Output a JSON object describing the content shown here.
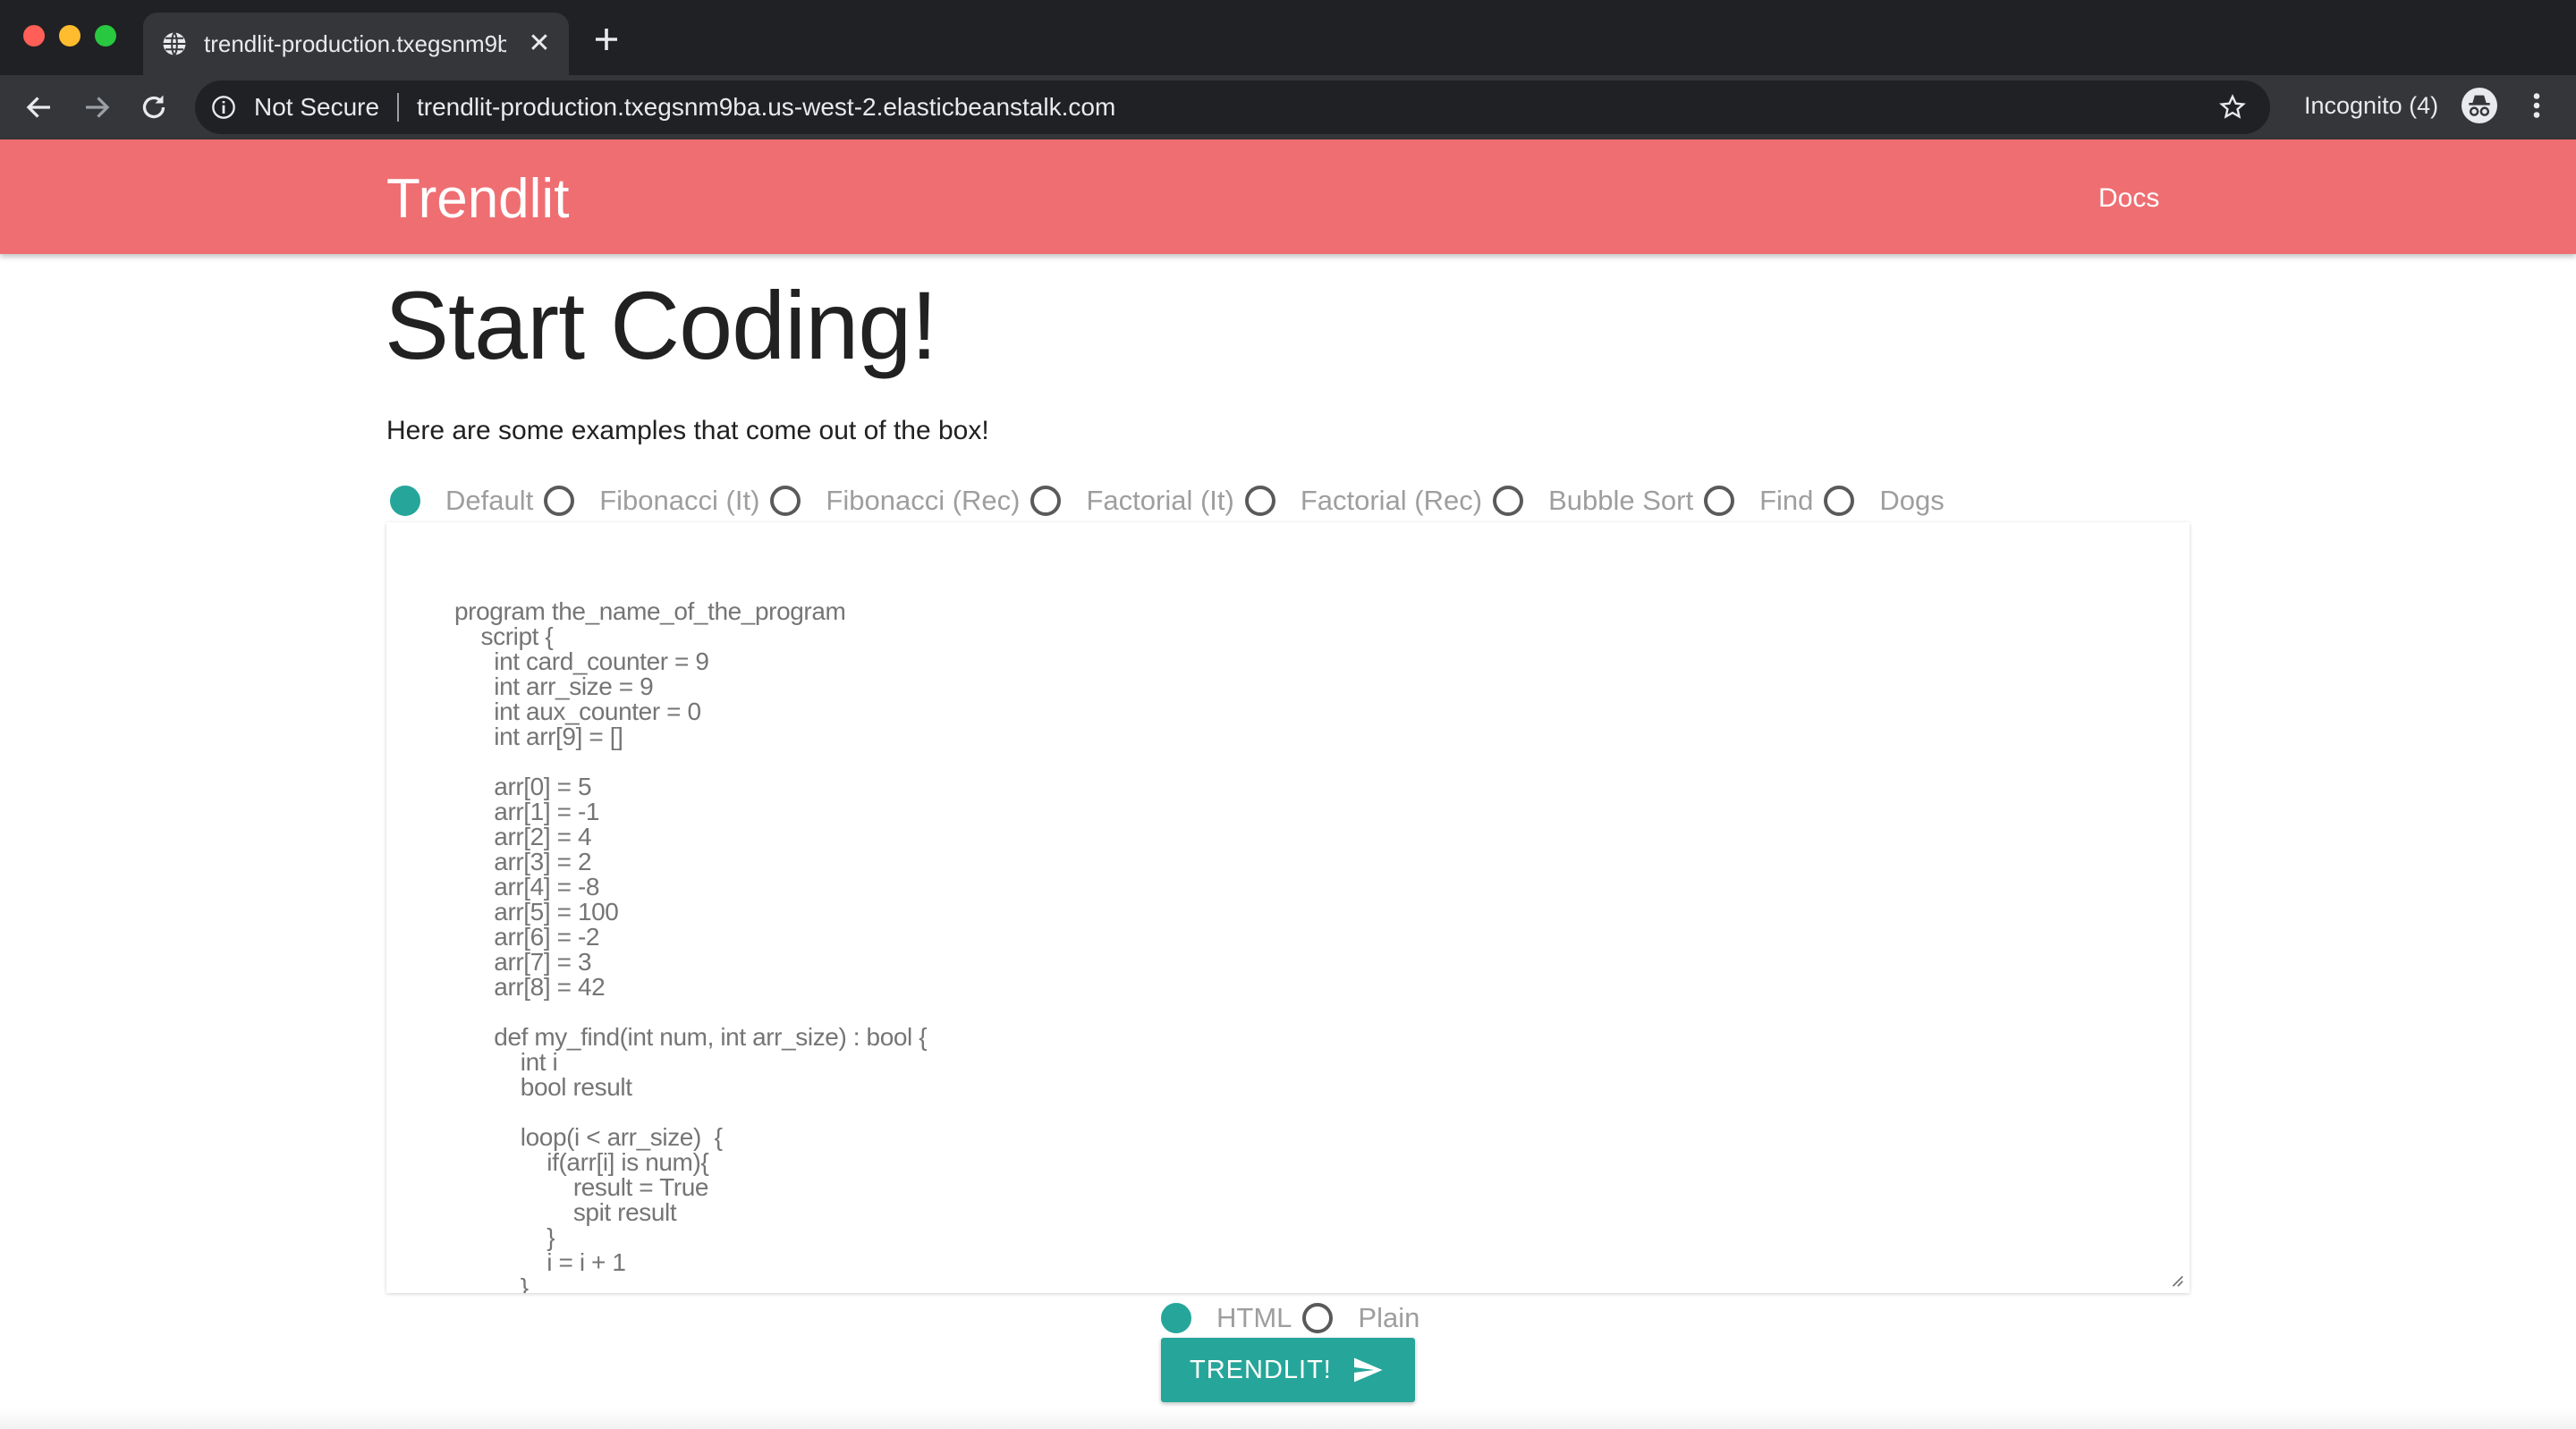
{
  "browser": {
    "tab_title": "trendlit-production.txegsnm9ba.us-west-2.elasticbeanstalk.com",
    "security_label": "Not Secure",
    "url": "trendlit-production.txegsnm9ba.us-west-2.elasticbeanstalk.com",
    "incognito_label": "Incognito (4)",
    "icons": [
      "globe-icon",
      "close-icon",
      "plus-icon",
      "back-icon",
      "forward-icon",
      "reload-icon",
      "info-icon",
      "star-icon",
      "incognito-icon",
      "more-vert-icon"
    ]
  },
  "navbar": {
    "brand": "Trendlit",
    "docs": "Docs",
    "color": "#ef6e72"
  },
  "main": {
    "title": "Start Coding!",
    "subtitle": "Here are some examples that come out of the box!",
    "examples": [
      {
        "label": "Default",
        "checked": true
      },
      {
        "label": "Fibonacci (It)",
        "checked": false
      },
      {
        "label": "Fibonacci (Rec)",
        "checked": false
      },
      {
        "label": "Factorial (It)",
        "checked": false
      },
      {
        "label": "Factorial (Rec)",
        "checked": false
      },
      {
        "label": "Bubble Sort",
        "checked": false
      },
      {
        "label": "Find",
        "checked": false
      },
      {
        "label": "Dogs",
        "checked": false
      }
    ],
    "code": "program the_name_of_the_program\n    script {\n      int card_counter = 9\n      int arr_size = 9\n      int aux_counter = 0\n      int arr[9] = []\n\n      arr[0] = 5\n      arr[1] = -1\n      arr[2] = 4\n      arr[3] = 2\n      arr[4] = -8\n      arr[5] = 100\n      arr[6] = -2\n      arr[7] = 3\n      arr[8] = 42\n\n      def my_find(int num, int arr_size) : bool {\n          int i\n          bool result\n\n          loop(i < arr_size)  {\n              if(arr[i] is num){\n                  result = True\n                  spit result\n              }\n              i = i + 1\n          }",
    "output_formats": [
      {
        "label": "HTML",
        "checked": true
      },
      {
        "label": "Plain",
        "checked": false
      }
    ],
    "submit_label": "TRENDLIT!",
    "accent": "#26a69a"
  }
}
